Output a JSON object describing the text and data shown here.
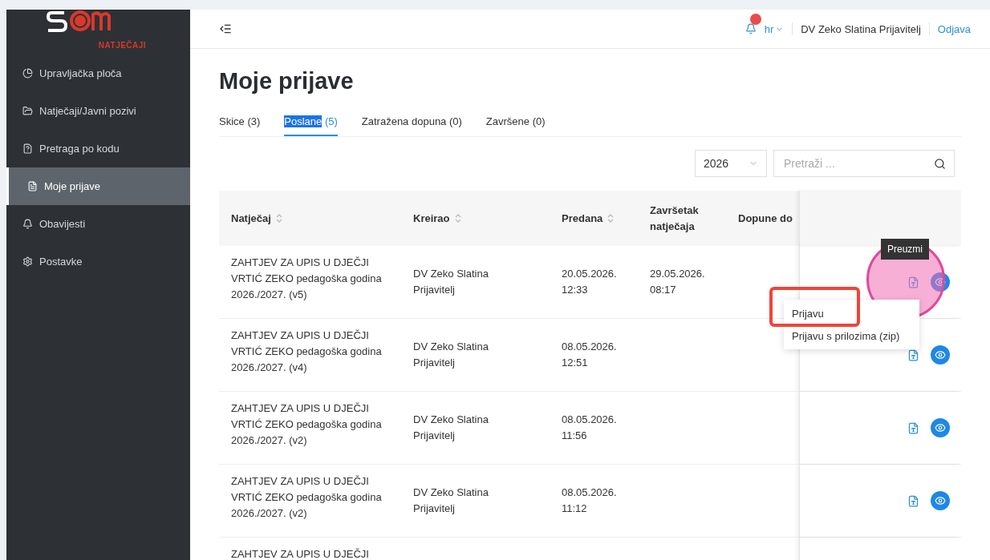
{
  "sidebar": {
    "logo_caption": "NATJEČAJI",
    "items": [
      {
        "label": "Upravljačka ploča",
        "selected": false
      },
      {
        "label": "Natječaji/Javni pozivi",
        "selected": false
      },
      {
        "label": "Pretraga po kodu",
        "selected": false
      },
      {
        "label": "Moje prijave",
        "selected": true
      },
      {
        "label": "Obavijesti",
        "selected": false
      },
      {
        "label": "Postavke",
        "selected": false
      }
    ]
  },
  "header": {
    "language": "hr",
    "user": "DV Zeko Slatina Prijavitelj",
    "logout": "Odjava"
  },
  "page_title": "Moje prijave",
  "tabs": [
    {
      "label": "Skice",
      "count": "(3)",
      "selected": false,
      "text_highlighted": false
    },
    {
      "label": "Poslane",
      "count": "(5)",
      "selected": true,
      "text_highlighted": true
    },
    {
      "label": "Zatražena dopuna",
      "count": "(0)",
      "selected": false,
      "text_highlighted": false
    },
    {
      "label": "Završene",
      "count": "(0)",
      "selected": false,
      "text_highlighted": false
    }
  ],
  "filters": {
    "year": "2026",
    "search": {
      "placeholder": "Pretraži ..."
    }
  },
  "table": {
    "columns": [
      {
        "label": "Natječaj",
        "sortable": true
      },
      {
        "label": "Kreirao",
        "sortable": true
      },
      {
        "label": "Predana",
        "sortable": true
      },
      {
        "label": "Završetak natječaja",
        "sortable": false
      },
      {
        "label": "Dopune do",
        "sortable": false
      }
    ],
    "rows": [
      {
        "title": "ZAHTJEV ZA UPIS U DJEČJI VRTIĆ ZEKO pedagoška godina 2026./2027. (v5)",
        "creator": "DV Zeko Slatina Prijavitelj",
        "submitted": "20.05.2026. 12:33",
        "deadline": "29.05.2026. 08:17"
      },
      {
        "title": "ZAHTJEV ZA UPIS U DJEČJI VRTIĆ ZEKO pedagoška godina 2026./2027. (v4)",
        "creator": "DV Zeko Slatina Prijavitelj",
        "submitted": "08.05.2026. 12:51"
      },
      {
        "title": "ZAHTJEV ZA UPIS U DJEČJI VRTIĆ ZEKO pedagoška godina 2026./2027. (v2)",
        "creator": "DV Zeko Slatina Prijavitelj",
        "submitted": "08.05.2026. 11:56"
      },
      {
        "title": "ZAHTJEV ZA UPIS U DJEČJI VRTIĆ ZEKO pedagoška godina 2026./2027. (v2)",
        "creator": "DV Zeko Slatina Prijavitelj",
        "submitted": "08.05.2026. 11:12"
      },
      {
        "title": "ZAHTJEV ZA UPIS U DJEČJI"
      }
    ]
  },
  "tooltip": "Preuzmi",
  "download_menu": [
    "Prijavu",
    "Prijavu s prilozima (zip)"
  ]
}
